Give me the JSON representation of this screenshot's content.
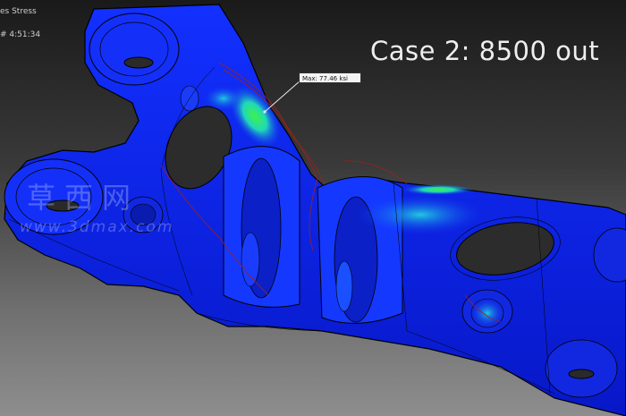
{
  "hud": {
    "title_text": "es Stress",
    "time_text": "# 4:51:34"
  },
  "annotation": {
    "case_label": "Case 2: 8500 out",
    "max_probe": "Max: 77.46 ksi"
  },
  "watermark": {
    "chinese": "草西网",
    "url": "www.3dmax.com"
  },
  "colors": {
    "low_stress": "#0a1ef0",
    "mid_stress": "#10d8d8",
    "high_stress": "#2ef040",
    "deformed_outline": "#a0201a",
    "mesh_edges": "#000000"
  }
}
